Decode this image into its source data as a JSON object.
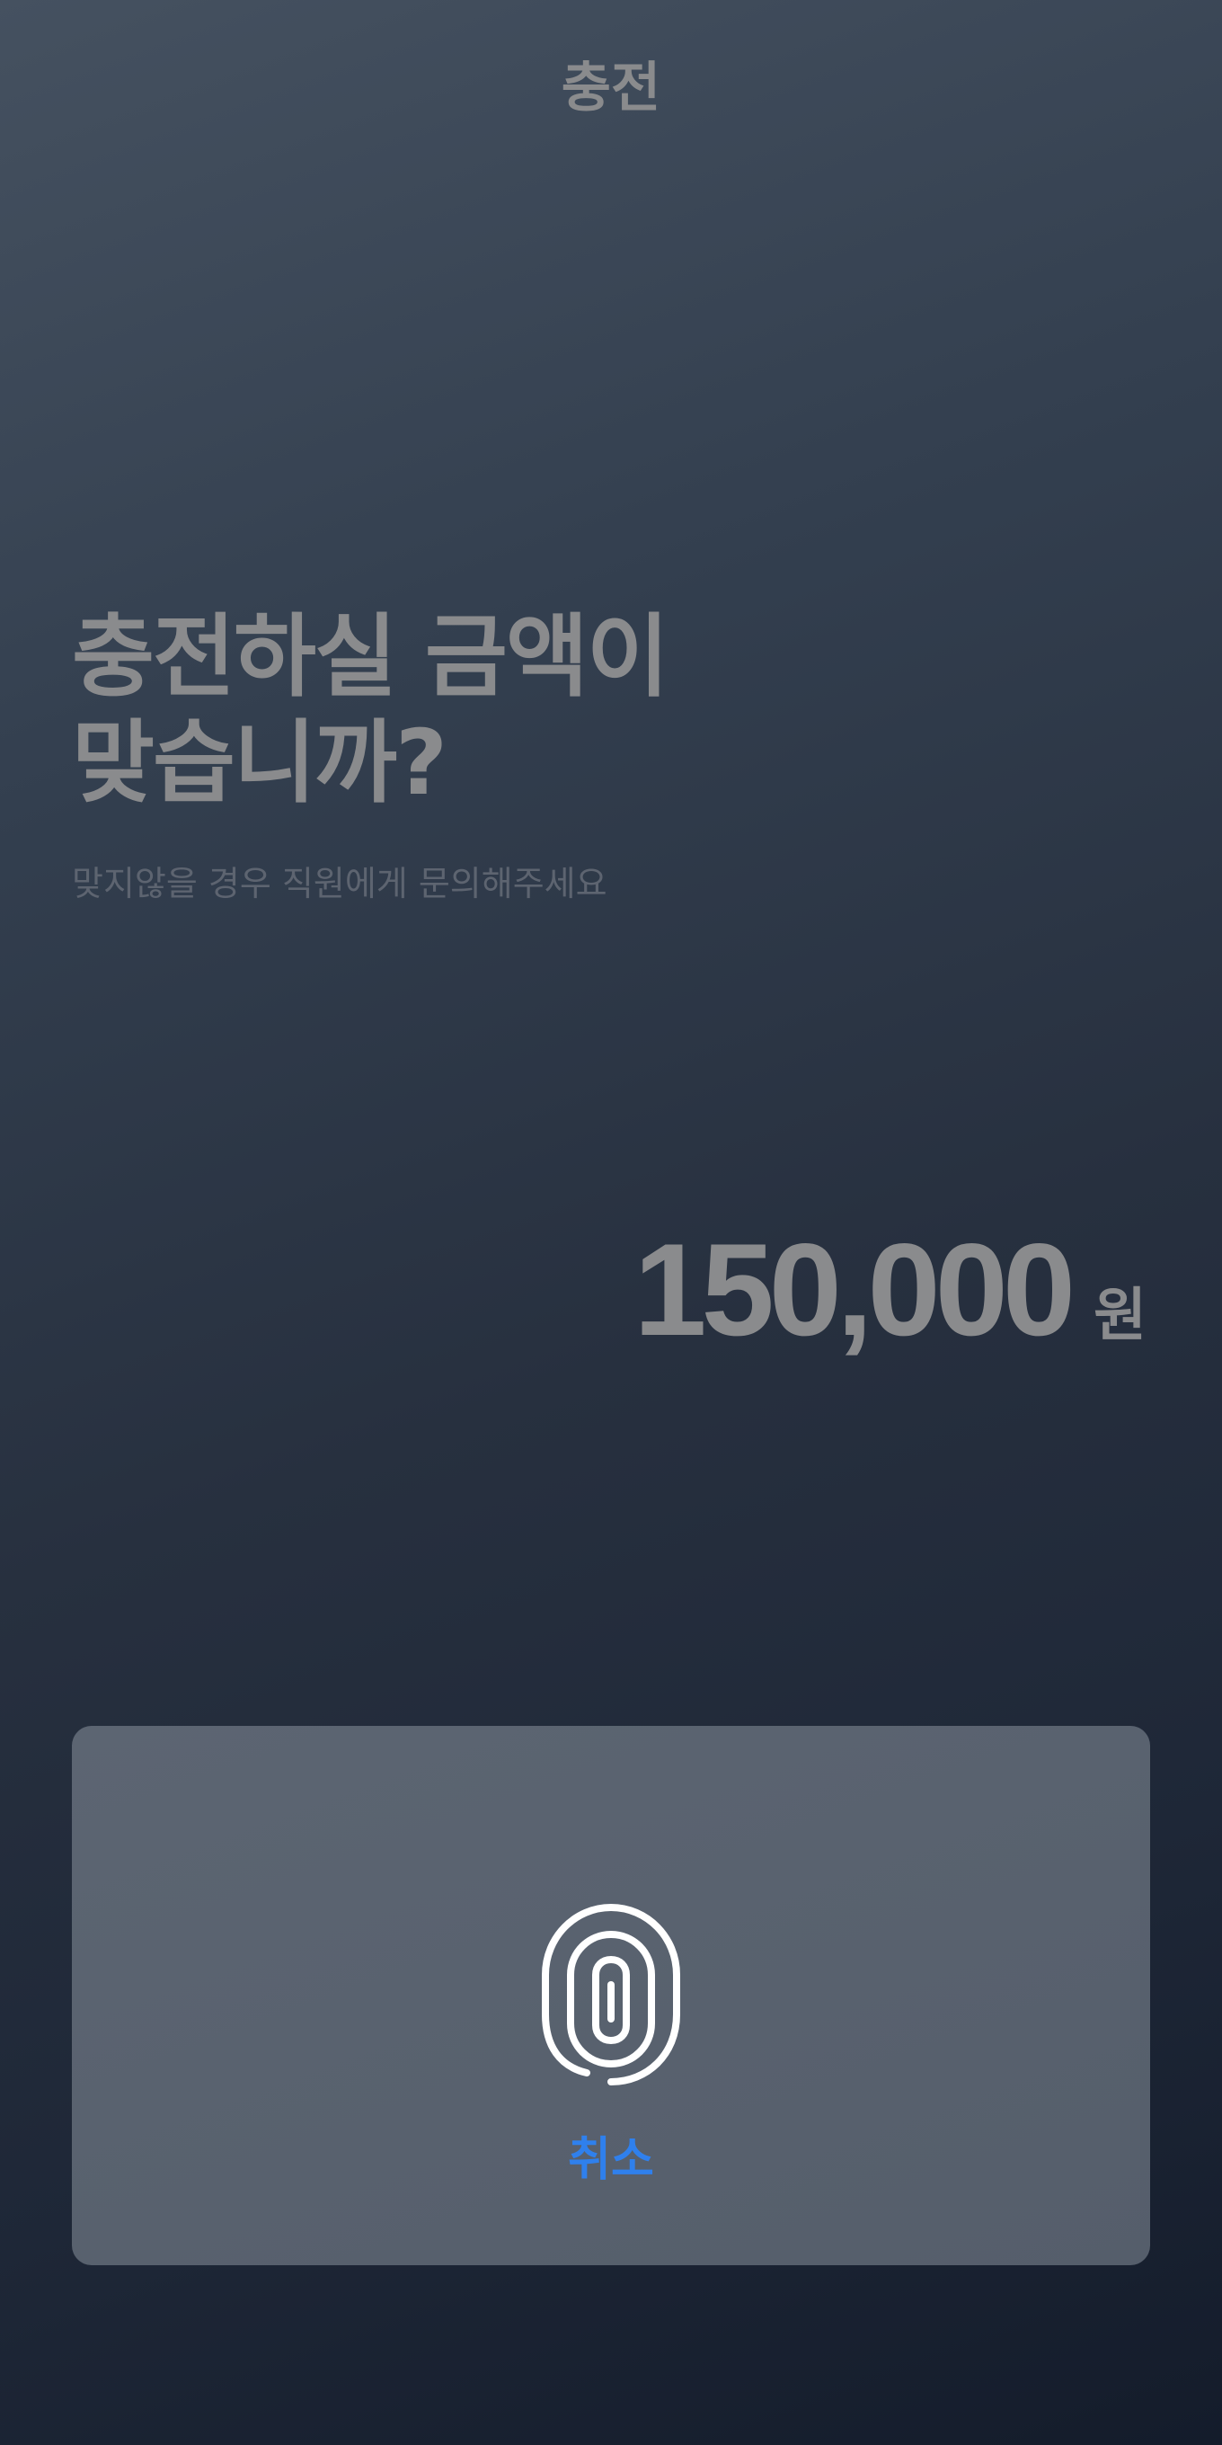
{
  "header": {
    "title": "충전"
  },
  "main": {
    "headline_line1": "충전하실 금액이",
    "headline_line2": "맞습니까?",
    "subtext": "맞지않을 경우 직원에게 문의해주세요",
    "amount": "150,000",
    "currency_unit": "원"
  },
  "auth_panel": {
    "icon": "fingerprint-icon",
    "cancel_label": "취소"
  },
  "colors": {
    "accent": "#2f80ed",
    "muted_text": "#8a8b8d",
    "panel": "#59626f"
  }
}
